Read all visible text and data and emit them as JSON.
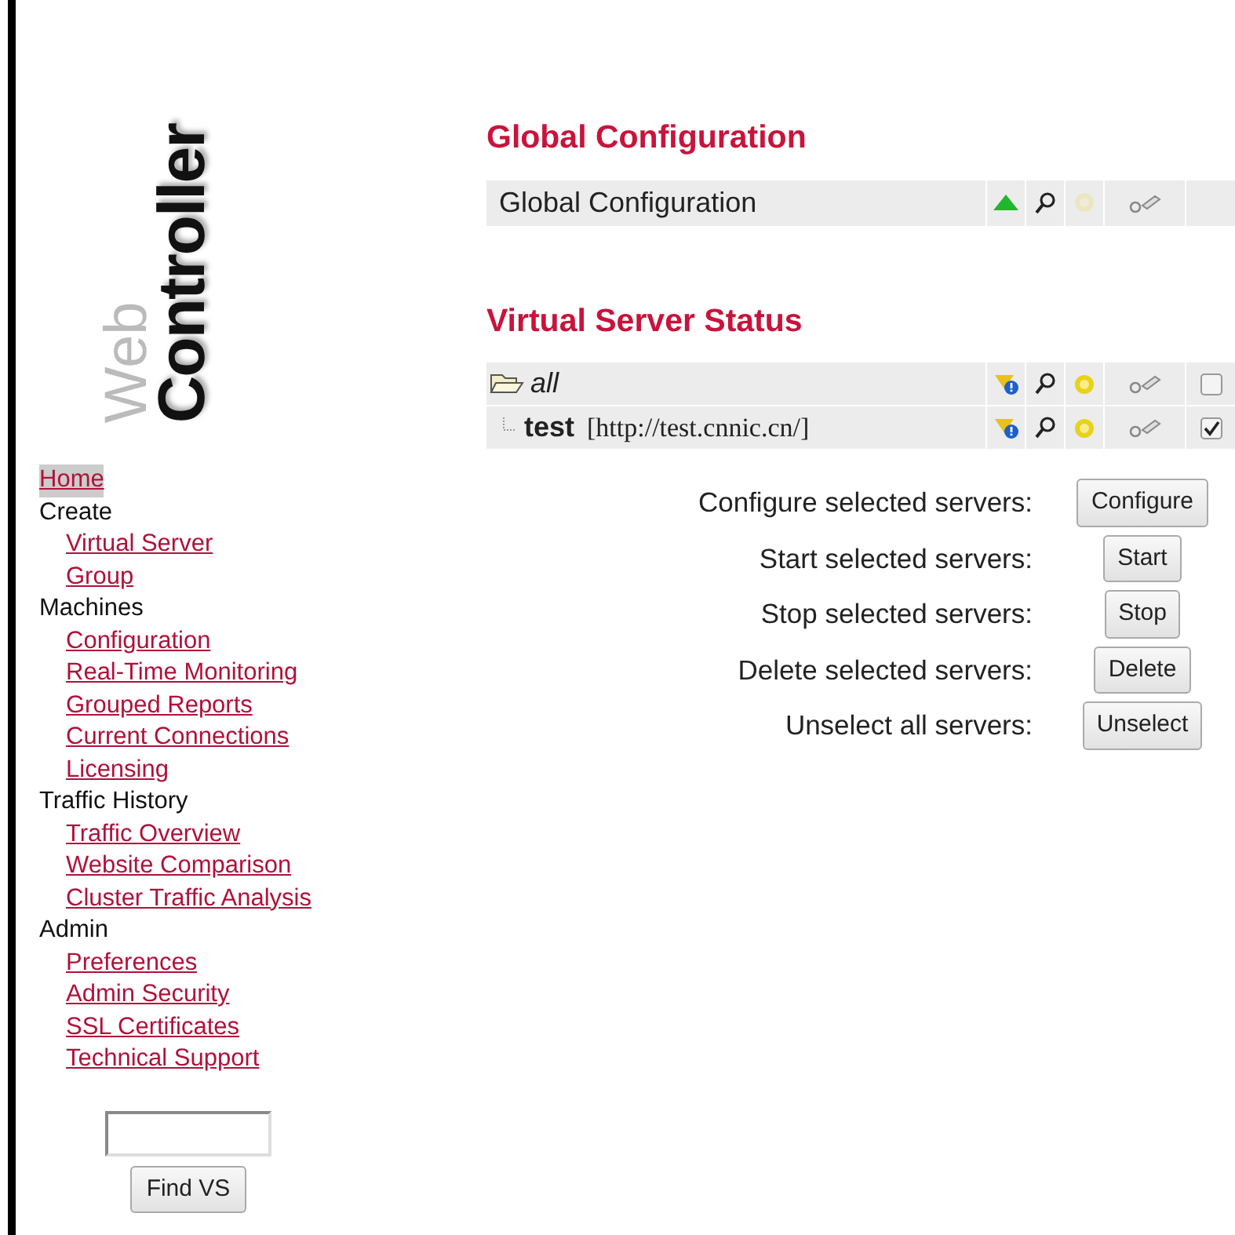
{
  "logo": {
    "prefix": "Web",
    "title": "Controller"
  },
  "nav": [
    {
      "label": "Home",
      "kind": "link",
      "selected": true
    },
    {
      "label": "Create",
      "kind": "heading",
      "children": [
        {
          "label": "Virtual Server",
          "selected": false
        },
        {
          "label": "Group",
          "selected": false
        }
      ]
    },
    {
      "label": "Machines",
      "kind": "heading",
      "children": [
        {
          "label": "Configuration",
          "selected": false
        },
        {
          "label": "Real-Time Monitoring",
          "selected": false
        },
        {
          "label": "Grouped Reports",
          "selected": false
        },
        {
          "label": "Current Connections",
          "selected": false
        },
        {
          "label": "Licensing",
          "selected": false
        }
      ]
    },
    {
      "label": "Traffic History",
      "kind": "heading",
      "children": [
        {
          "label": "Traffic Overview",
          "selected": false
        },
        {
          "label": "Website Comparison",
          "selected": false
        },
        {
          "label": "Cluster Traffic Analysis",
          "selected": false
        }
      ]
    },
    {
      "label": "Admin",
      "kind": "heading",
      "children": [
        {
          "label": "Preferences",
          "selected": false
        },
        {
          "label": "Admin Security",
          "selected": false
        },
        {
          "label": "SSL Certificates",
          "selected": false
        },
        {
          "label": "Technical Support",
          "selected": false
        }
      ]
    }
  ],
  "search": {
    "button": "Find VS"
  },
  "global": {
    "heading": "Global Configuration",
    "label": "Global Configuration",
    "actions": [
      {
        "kind": "status-up",
        "disabled": false
      },
      {
        "kind": "view",
        "disabled": false
      },
      {
        "kind": "start",
        "disabled": true
      },
      {
        "kind": "configure",
        "disabled": false
      }
    ]
  },
  "servers": {
    "heading": "Virtual Server Status",
    "rows": [
      {
        "name": "all",
        "kind": "folder",
        "checked": false,
        "actions": [
          {
            "kind": "warning",
            "disabled": false
          },
          {
            "kind": "view",
            "disabled": false
          },
          {
            "kind": "start",
            "disabled": false
          },
          {
            "kind": "configure",
            "disabled": false
          }
        ],
        "children": [
          {
            "name": "test",
            "kind": "server",
            "url": "[http://test.cnnic.cn/]",
            "checked": true,
            "actions": [
              {
                "kind": "warning",
                "disabled": false
              },
              {
                "kind": "view",
                "disabled": false
              },
              {
                "kind": "start",
                "disabled": false
              },
              {
                "kind": "configure",
                "disabled": false
              }
            ]
          }
        ]
      }
    ]
  },
  "operations": [
    {
      "label": "Configure selected servers:",
      "button": "Configure"
    },
    {
      "label": "Start selected servers:",
      "button": "Start"
    },
    {
      "label": "Stop selected servers:",
      "button": "Stop"
    },
    {
      "label": "Delete selected servers:",
      "button": "Delete"
    },
    {
      "label": "Unselect all servers:",
      "button": "Unselect"
    }
  ]
}
